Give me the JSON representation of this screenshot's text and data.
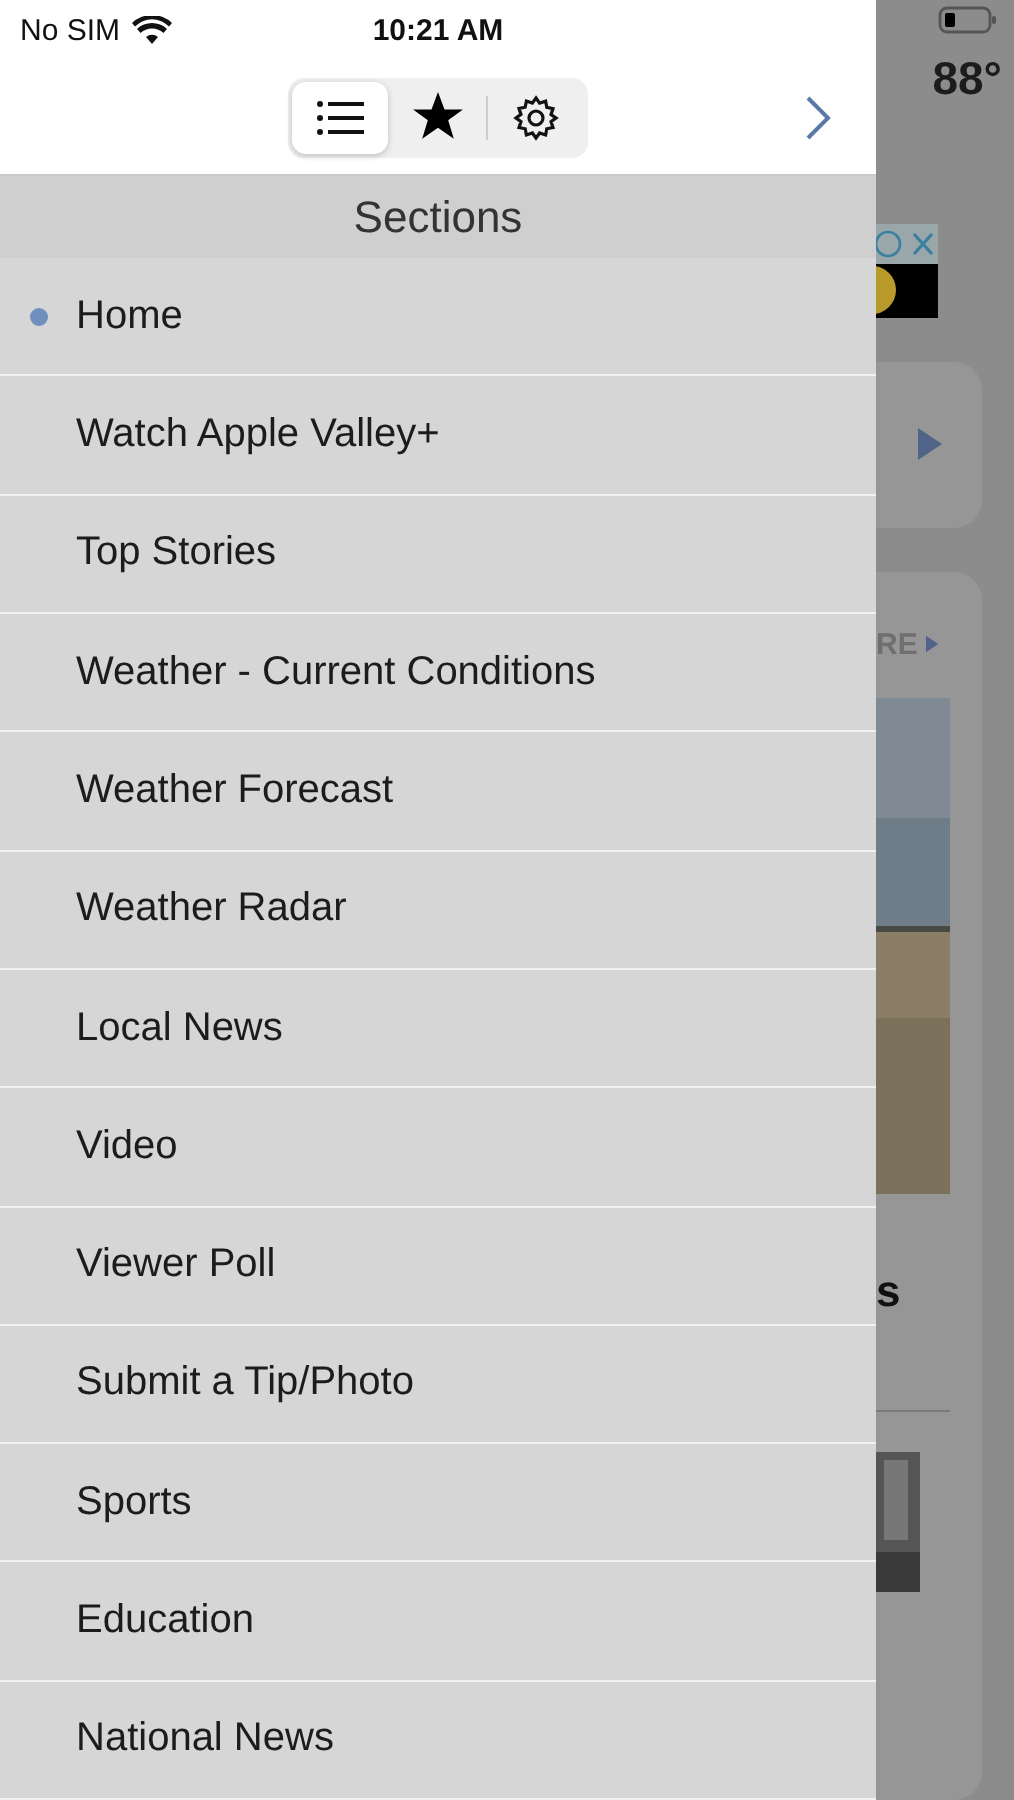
{
  "status_bar": {
    "carrier": "No SIM",
    "time": "10:21 AM"
  },
  "toolbar": {
    "segments": [
      {
        "kind": "list",
        "selected": true
      },
      {
        "kind": "star",
        "selected": false
      },
      {
        "kind": "settings",
        "selected": false
      }
    ]
  },
  "sidebar": {
    "title": "Sections",
    "items": [
      {
        "label": "Home",
        "selected": true
      },
      {
        "label": "Watch Apple Valley+",
        "selected": false
      },
      {
        "label": "Top Stories",
        "selected": false
      },
      {
        "label": "Weather - Current Conditions",
        "selected": false
      },
      {
        "label": "Weather Forecast",
        "selected": false
      },
      {
        "label": "Weather Radar",
        "selected": false
      },
      {
        "label": "Local News",
        "selected": false
      },
      {
        "label": "Video",
        "selected": false
      },
      {
        "label": "Viewer Poll",
        "selected": false
      },
      {
        "label": "Submit a Tip/Photo",
        "selected": false
      },
      {
        "label": "Sports",
        "selected": false
      },
      {
        "label": "Education",
        "selected": false
      },
      {
        "label": "National News",
        "selected": false
      }
    ]
  },
  "background": {
    "temperature": "88°",
    "more_link": "RE",
    "heading": "s"
  }
}
